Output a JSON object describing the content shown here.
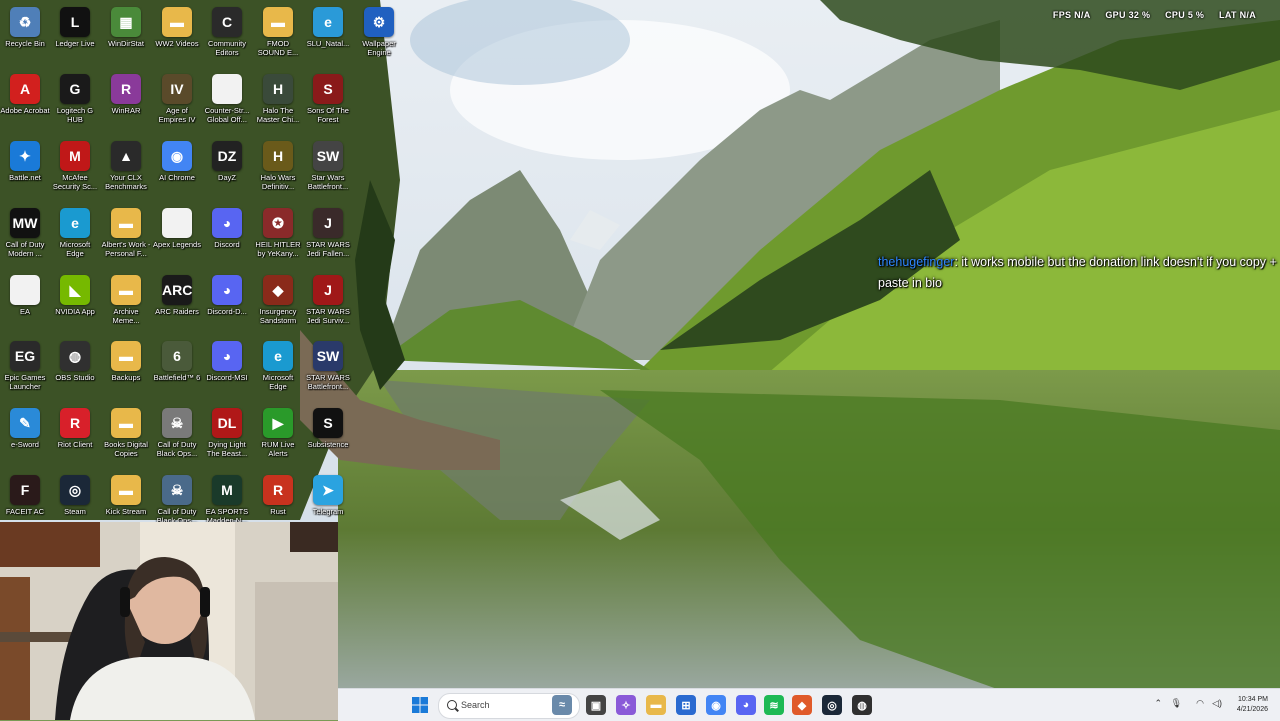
{
  "overlay": {
    "fps_label": "FPS",
    "fps_value": "N/A",
    "gpu_label": "GPU",
    "gpu_value": "32 %",
    "cpu_label": "CPU",
    "cpu_value": "5 %",
    "lat_label": "LAT",
    "lat_value": "N/A"
  },
  "chat": {
    "username": "thehugefinger",
    "message": ": it works mobile but the donation link doesn't if you copy + paste in bio"
  },
  "desktop_icons": [
    {
      "label": "Recycle Bin",
      "icon": "recycle-bin-icon",
      "color": "#4f7fb8",
      "glyph": "♻"
    },
    {
      "label": "Ledger Live",
      "icon": "ledger-icon",
      "color": "#111111",
      "glyph": "L"
    },
    {
      "label": "WinDirStat",
      "icon": "windirstat-icon",
      "color": "#4a8a3a",
      "glyph": "▦"
    },
    {
      "label": "WW2 Videos",
      "icon": "folder-icon",
      "color": "#e8b84a",
      "glyph": "▬"
    },
    {
      "label": "Community Editors",
      "icon": "community-icon",
      "color": "#2a2a2a",
      "glyph": "C"
    },
    {
      "label": "FMOD SOUND E...",
      "icon": "folder-icon",
      "color": "#e8b84a",
      "glyph": "▬"
    },
    {
      "label": "SLU_Natal...",
      "icon": "edge-icon",
      "color": "#2a9ad8",
      "glyph": "e"
    },
    {
      "label": "Wallpaper Engine",
      "icon": "wallpaper-engine-icon",
      "color": "#2060c0",
      "glyph": "⚙"
    },
    {
      "label": "Adobe Acrobat",
      "icon": "acrobat-icon",
      "color": "#d2201e",
      "glyph": "A"
    },
    {
      "label": "Logitech G HUB",
      "icon": "logitech-icon",
      "color": "#1a1a1a",
      "glyph": "G"
    },
    {
      "label": "WinRAR",
      "icon": "winrar-icon",
      "color": "#8a3a9a",
      "glyph": "R"
    },
    {
      "label": "Age of Empires IV",
      "icon": "aoe-icon",
      "color": "#5a4a2a",
      "glyph": "IV"
    },
    {
      "label": "Counter-Str... Global Off...",
      "icon": "file-icon",
      "color": "#f2f2f2",
      "glyph": ""
    },
    {
      "label": "Halo The Master Chi...",
      "icon": "halo-icon",
      "color": "#3a4a3a",
      "glyph": "H"
    },
    {
      "label": "Sons Of The Forest",
      "icon": "sotf-icon",
      "color": "#8a1a1a",
      "glyph": "S"
    },
    {
      "label": "Battle.net",
      "icon": "battlenet-icon",
      "color": "#1a7ad8",
      "glyph": "✦"
    },
    {
      "label": "McAfee Security Sc...",
      "icon": "mcafee-icon",
      "color": "#c01818",
      "glyph": "M"
    },
    {
      "label": "Your CLX Benchmarks",
      "icon": "clx-icon",
      "color": "#2a2a2a",
      "glyph": "▲"
    },
    {
      "label": "AI Chrome",
      "icon": "chrome-icon",
      "color": "#4285f4",
      "glyph": "◉"
    },
    {
      "label": "DayZ",
      "icon": "dayz-icon",
      "color": "#222222",
      "glyph": "DZ"
    },
    {
      "label": "Halo Wars Definitiv...",
      "icon": "halo-wars-icon",
      "color": "#6a5a1a",
      "glyph": "H"
    },
    {
      "label": "Star Wars Battlefront...",
      "icon": "swbf-icon",
      "color": "#444444",
      "glyph": "SW"
    },
    {
      "label": "Call of Duty Modern ...",
      "icon": "cod-mw-icon",
      "color": "#111111",
      "glyph": "MW"
    },
    {
      "label": "Microsoft Edge",
      "icon": "edge-icon",
      "color": "#1a9ad0",
      "glyph": "e"
    },
    {
      "label": "Albert's Work - Personal F...",
      "icon": "folder-icon",
      "color": "#e8b84a",
      "glyph": "▬"
    },
    {
      "label": "Apex Legends",
      "icon": "file-icon",
      "color": "#f2f2f2",
      "glyph": ""
    },
    {
      "label": "Discord",
      "icon": "discord-icon",
      "color": "#5865f2",
      "glyph": "◕"
    },
    {
      "label": "HEIL HITLER by YeKany...",
      "icon": "video-icon",
      "color": "#8a2a2a",
      "glyph": "✪"
    },
    {
      "label": "STAR WARS Jedi Fallen...",
      "icon": "swjf-icon",
      "color": "#3a2a2a",
      "glyph": "J"
    },
    {
      "label": "EA",
      "icon": "file-icon",
      "color": "#f2f2f2",
      "glyph": ""
    },
    {
      "label": "NVIDIA App",
      "icon": "nvidia-icon",
      "color": "#76b900",
      "glyph": "◣"
    },
    {
      "label": "Archive Meme...",
      "icon": "folder-icon",
      "color": "#e8b84a",
      "glyph": "▬"
    },
    {
      "label": "ARC Raiders",
      "icon": "arc-raiders-icon",
      "color": "#1a1a1a",
      "glyph": "ARC"
    },
    {
      "label": "Discord-D...",
      "icon": "discord-icon",
      "color": "#5865f2",
      "glyph": "◕"
    },
    {
      "label": "Insurgency Sandstorm",
      "icon": "insurgency-icon",
      "color": "#8a2a1a",
      "glyph": "◆"
    },
    {
      "label": "STAR WARS Jedi Surviv...",
      "icon": "swjs-icon",
      "color": "#a01818",
      "glyph": "J"
    },
    {
      "label": "Epic Games Launcher",
      "icon": "epic-icon",
      "color": "#2a2a2a",
      "glyph": "EG"
    },
    {
      "label": "OBS Studio",
      "icon": "obs-icon",
      "color": "#303030",
      "glyph": "◍"
    },
    {
      "label": "Backups",
      "icon": "folder-icon",
      "color": "#e8b84a",
      "glyph": "▬"
    },
    {
      "label": "Battlefield™ 6",
      "icon": "bf6-icon",
      "color": "#4a5a3a",
      "glyph": "6"
    },
    {
      "label": "Discord-MSI",
      "icon": "discord-icon",
      "color": "#5865f2",
      "glyph": "◕"
    },
    {
      "label": "Microsoft Edge",
      "icon": "edge-icon",
      "color": "#1a9ad0",
      "glyph": "e"
    },
    {
      "label": "STAR WARS Battlefront...",
      "icon": "swbf2-icon",
      "color": "#2a3a6a",
      "glyph": "SW"
    },
    {
      "label": "e-Sword",
      "icon": "esword-icon",
      "color": "#2a8ad8",
      "glyph": "✎"
    },
    {
      "label": "Riot Client",
      "icon": "riot-icon",
      "color": "#d8202a",
      "glyph": "R"
    },
    {
      "label": "Books Digital Copies",
      "icon": "folder-icon",
      "color": "#e8b84a",
      "glyph": "▬"
    },
    {
      "label": "Call of Duty Black Ops...",
      "icon": "cod-bo-icon",
      "color": "#7a7a7a",
      "glyph": "☠"
    },
    {
      "label": "Dying Light The Beast...",
      "icon": "dying-light-icon",
      "color": "#b01818",
      "glyph": "DL"
    },
    {
      "label": "RUM Live Alerts",
      "icon": "rumble-icon",
      "color": "#2a9a2a",
      "glyph": "▶"
    },
    {
      "label": "Subsistence",
      "icon": "subsistence-icon",
      "color": "#111111",
      "glyph": "S"
    },
    {
      "label": "FACEIT AC",
      "icon": "faceit-icon",
      "color": "#2a1a1a",
      "glyph": "F"
    },
    {
      "label": "Steam",
      "icon": "steam-icon",
      "color": "#1b2838",
      "glyph": "◎"
    },
    {
      "label": "Kick Stream",
      "icon": "folder-icon",
      "color": "#e8b84a",
      "glyph": "▬"
    },
    {
      "label": "Call of Duty Black Ops...",
      "icon": "cod-bo-icon",
      "color": "#4a6a8a",
      "glyph": "☠"
    },
    {
      "label": "EA SPORTS Madden N...",
      "icon": "madden-icon",
      "color": "#1a3a2a",
      "glyph": "M"
    },
    {
      "label": "Rust",
      "icon": "rust-icon",
      "color": "#c8321e",
      "glyph": "R"
    },
    {
      "label": "Telegram",
      "icon": "telegram-icon",
      "color": "#2aa3e0",
      "glyph": "➤"
    }
  ],
  "taskbar": {
    "search_placeholder": "Search",
    "time": "10:34 PM",
    "date": "4/21/2026",
    "pinned": [
      {
        "name": "widgets-icon",
        "color": "#6a8aaa",
        "glyph": "≈"
      },
      {
        "name": "task-view-icon",
        "color": "#444444",
        "glyph": "▣"
      },
      {
        "name": "copilot-icon",
        "color": "#8a5ad8",
        "glyph": "✧"
      },
      {
        "name": "file-explorer-icon",
        "color": "#e8b84a",
        "glyph": "▬"
      },
      {
        "name": "store-icon",
        "color": "#2a6ad0",
        "glyph": "⊞"
      },
      {
        "name": "chrome-icon",
        "color": "#4285f4",
        "glyph": "◉"
      },
      {
        "name": "discord-icon",
        "color": "#5865f2",
        "glyph": "◕"
      },
      {
        "name": "spotify-icon",
        "color": "#1db954",
        "glyph": "≋"
      },
      {
        "name": "app-icon",
        "color": "#e05a2a",
        "glyph": "◆"
      },
      {
        "name": "steam-icon",
        "color": "#1b2838",
        "glyph": "◎"
      },
      {
        "name": "obs-icon",
        "color": "#303030",
        "glyph": "◍"
      }
    ]
  }
}
